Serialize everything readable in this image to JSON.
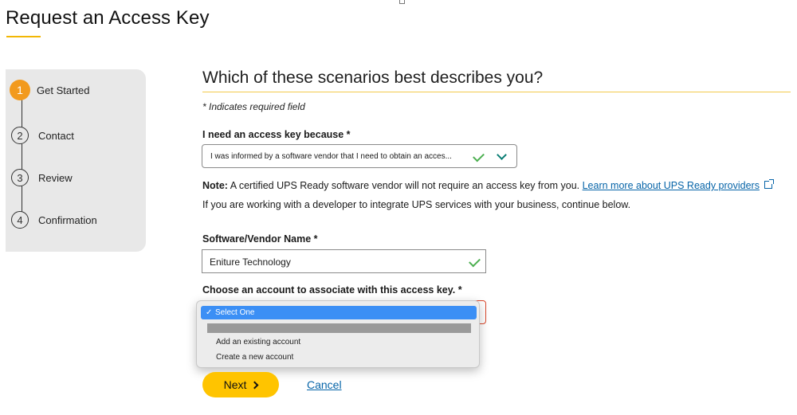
{
  "page": {
    "title": "Request an Access Key"
  },
  "stepper": {
    "steps": [
      {
        "number": "1",
        "label": "Get Started",
        "active": true
      },
      {
        "number": "2",
        "label": "Contact",
        "active": false
      },
      {
        "number": "3",
        "label": "Review",
        "active": false
      },
      {
        "number": "4",
        "label": "Confirmation",
        "active": false
      }
    ]
  },
  "form": {
    "heading": "Which of these scenarios best describes you?",
    "required_note": "* Indicates required field",
    "reason": {
      "label": "I need an access key because *",
      "value": "I was informed by a software vendor that I need to obtain an acces..."
    },
    "note": {
      "prefix": "Note:",
      "text": " A certified UPS Ready software vendor will not require an access key from you. ",
      "link": "Learn more about UPS Ready providers"
    },
    "continue_text": "If you are working with a developer to integrate UPS services with your business, continue below.",
    "vendor": {
      "label": "Software/Vendor Name *",
      "value": "Eniture Technology"
    },
    "account": {
      "label": "Choose an account to associate with this access key. *",
      "options": {
        "selected": "Select One",
        "check": "✓",
        "items": [
          "Add an existing account",
          "Create a new account"
        ]
      }
    },
    "next_label": "Next",
    "cancel_label": "Cancel"
  },
  "colors": {
    "accent_yellow": "#ffc400",
    "step_active": "#f29a1d",
    "link_blue": "#0664a8",
    "valid_green": "#4caf50",
    "error_red": "#d9472b",
    "option_highlight": "#3b8ff5"
  }
}
